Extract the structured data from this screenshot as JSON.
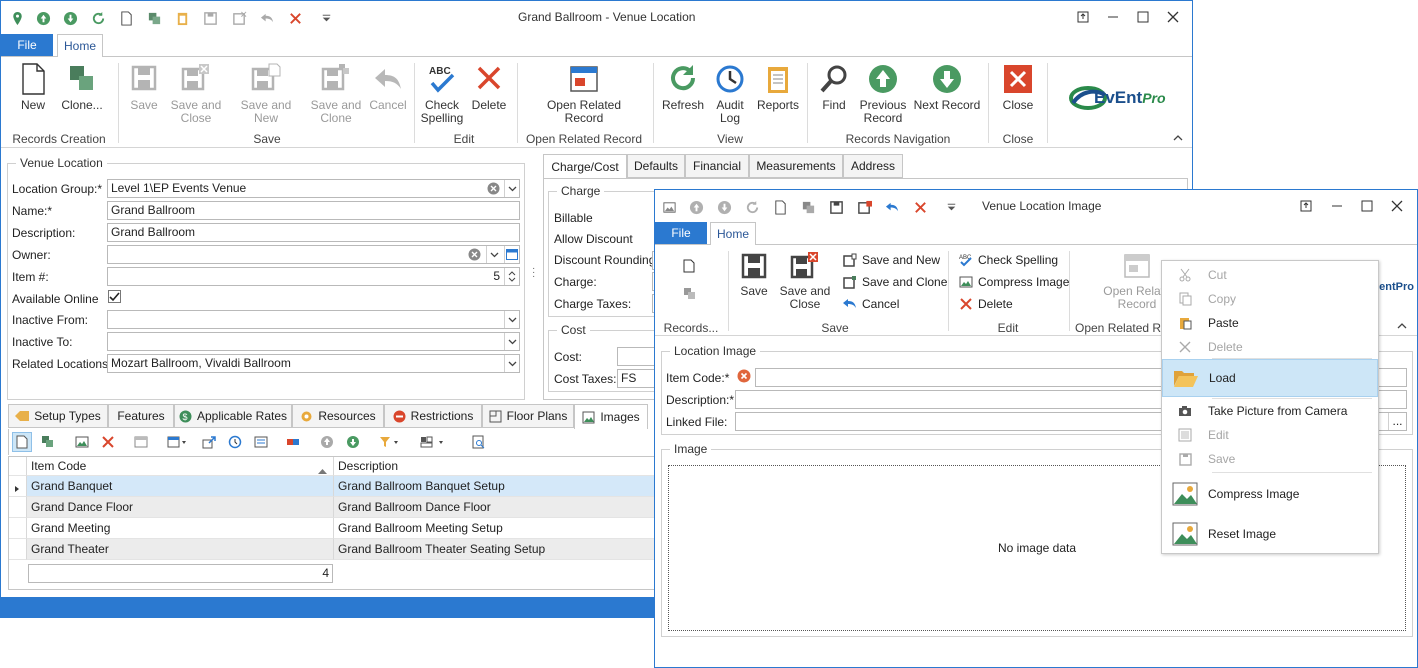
{
  "main": {
    "title": "Grand Ballroom - Venue Location",
    "file_tab": "File",
    "home_tab": "Home",
    "ribbon": {
      "new": "New",
      "clone": "Clone...",
      "records_creation": "Records Creation",
      "save": "Save",
      "save_close_1": "Save and",
      "save_close_2": "Close",
      "save_new": "Save and New",
      "save_clone_1": "Save and",
      "save_clone_2": "Clone",
      "cancel": "Cancel",
      "save_group": "Save",
      "check_1": "Check",
      "check_2": "Spelling",
      "delete": "Delete",
      "edit_group": "Edit",
      "orr_1": "Open Related",
      "orr_2": "Record",
      "orr_group": "Open Related Record",
      "refresh": "Refresh",
      "audit_1": "Audit",
      "audit_2": "Log",
      "reports": "Reports",
      "view_group": "View",
      "find": "Find",
      "prev_1": "Previous",
      "prev_2": "Record",
      "next": "Next Record",
      "nav_group": "Records Navigation",
      "close": "Close",
      "close_group": "Close",
      "logo_a": "EvEnt",
      "logo_b": "Pro",
      "abc": "ABC"
    },
    "venue": {
      "group_title": "Venue Location",
      "location_group_label": "Location Group:*",
      "location_group": "Level 1\\EP Events Venue",
      "name_label": "Name:*",
      "name": "Grand Ballroom",
      "desc_label": "Description:",
      "desc": "Grand Ballroom",
      "owner_label": "Owner:",
      "owner": "",
      "item_label": "Item #:",
      "item": "5",
      "online_label": "Available Online",
      "inactive_from_label": "Inactive From:",
      "inactive_to_label": "Inactive To:",
      "related_label": "Related Locations:",
      "related": "Mozart Ballroom, Vivaldi Ballroom"
    },
    "right_tabs": [
      "Charge/Cost",
      "Defaults",
      "Financial",
      "Measurements",
      "Address"
    ],
    "charge": {
      "title": "Charge",
      "billable": "Billable",
      "allow_discount": "Allow Discount",
      "discount_rounding": "Discount Rounding:",
      "charge": "Charge:",
      "charge_taxes": "Charge Taxes:"
    },
    "cost": {
      "title": "Cost",
      "cost": "Cost:",
      "cost_taxes": "Cost Taxes:",
      "cost_taxes_value": "FS"
    },
    "bottom_tabs": [
      "Setup Types",
      "Features",
      "Applicable Rates",
      "Resources",
      "Restrictions",
      "Floor Plans",
      "Images"
    ],
    "grid": {
      "col1": "Item Code",
      "col2": "Description",
      "rows": [
        {
          "code": "Grand Banquet",
          "desc": "Grand Ballroom Banquet Setup"
        },
        {
          "code": "Grand Dance Floor",
          "desc": "Grand Ballroom Dance Floor"
        },
        {
          "code": "Grand Meeting",
          "desc": "Grand Ballroom Meeting Setup"
        },
        {
          "code": "Grand Theater",
          "desc": "Grand Ballroom Theater Seating Setup"
        }
      ],
      "count": "4"
    }
  },
  "sub": {
    "title": "Venue Location Image",
    "file_tab": "File",
    "home_tab": "Home",
    "ribbon": {
      "records": "Records...",
      "save": "Save",
      "save_close_1": "Save and",
      "save_close_2": "Close",
      "save_new": "Save and New",
      "save_clone": "Save and Clone",
      "cancel": "Cancel",
      "save_group": "Save",
      "check": "Check Spelling",
      "compress": "Compress Image",
      "delete": "Delete",
      "edit_group": "Edit",
      "orr_1": "Open Relate",
      "orr_2": "Record",
      "orr_group": "Open Related R",
      "logo": "ventPro",
      "abc": "ABC"
    },
    "loc_group": "Location Image",
    "item_code_label": "Item Code:*",
    "desc_label": "Description:*",
    "linked_label": "Linked File:",
    "image_group": "Image",
    "no_image": "No image data",
    "ellipsis": "..."
  },
  "menu": {
    "cut": "Cut",
    "copy": "Copy",
    "paste": "Paste",
    "delete": "Delete",
    "load": "Load",
    "take_picture": "Take Picture from Camera",
    "edit": "Edit",
    "save": "Save",
    "compress": "Compress Image",
    "reset": "Reset Image"
  }
}
